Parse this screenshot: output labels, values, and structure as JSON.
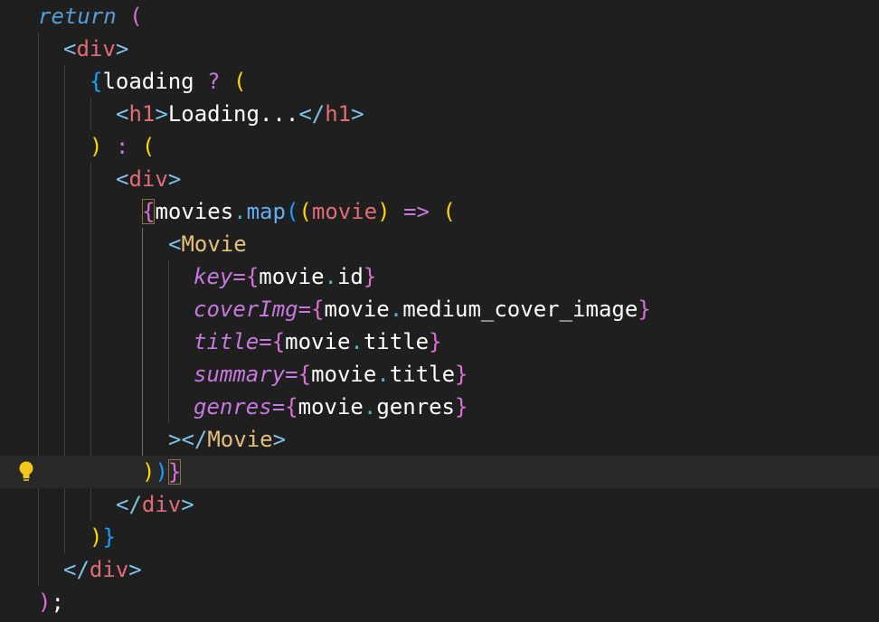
{
  "editor": {
    "lines": [
      {
        "tokens": [
          {
            "t": "return",
            "c": "ret"
          },
          {
            "t": " ",
            "c": "txt"
          },
          {
            "t": "(",
            "c": "b2"
          }
        ]
      },
      {
        "tokens": [
          {
            "t": "<",
            "c": "tagp"
          },
          {
            "t": "div",
            "c": "tag"
          },
          {
            "t": ">",
            "c": "tagp"
          }
        ]
      },
      {
        "tokens": [
          {
            "t": "{",
            "c": "b3"
          },
          {
            "t": "loading",
            "c": "var"
          },
          {
            "t": " ? ",
            "c": "op"
          },
          {
            "t": "(",
            "c": "b1"
          }
        ]
      },
      {
        "tokens": [
          {
            "t": "<",
            "c": "tagp"
          },
          {
            "t": "h1",
            "c": "tag"
          },
          {
            "t": ">",
            "c": "tagp"
          },
          {
            "t": "Loading...",
            "c": "txt"
          },
          {
            "t": "</",
            "c": "tagp"
          },
          {
            "t": "h1",
            "c": "tag"
          },
          {
            "t": ">",
            "c": "tagp"
          }
        ]
      },
      {
        "tokens": [
          {
            "t": ")",
            "c": "b1"
          },
          {
            "t": " : ",
            "c": "op"
          },
          {
            "t": "(",
            "c": "b1"
          }
        ]
      },
      {
        "tokens": [
          {
            "t": "<",
            "c": "tagp"
          },
          {
            "t": "div",
            "c": "tag"
          },
          {
            "t": ">",
            "c": "tagp"
          }
        ]
      },
      {
        "tokens": [
          {
            "t": "{",
            "c": "b2",
            "box": true
          },
          {
            "t": "movies",
            "c": "var"
          },
          {
            "t": ".",
            "c": "dot"
          },
          {
            "t": "map",
            "c": "fn"
          },
          {
            "t": "(",
            "c": "b3"
          },
          {
            "t": "(",
            "c": "b1"
          },
          {
            "t": "movie",
            "c": "param"
          },
          {
            "t": ")",
            "c": "b1"
          },
          {
            "t": " => ",
            "c": "op"
          },
          {
            "t": "(",
            "c": "b1"
          }
        ]
      },
      {
        "tokens": [
          {
            "t": "<",
            "c": "tagp"
          },
          {
            "t": "Movie",
            "c": "comp"
          }
        ]
      },
      {
        "tokens": [
          {
            "t": "key",
            "c": "attr"
          },
          {
            "t": "=",
            "c": "op"
          },
          {
            "t": "{",
            "c": "b2"
          },
          {
            "t": "movie",
            "c": "var"
          },
          {
            "t": ".",
            "c": "dot"
          },
          {
            "t": "id",
            "c": "var"
          },
          {
            "t": "}",
            "c": "b2"
          }
        ]
      },
      {
        "tokens": [
          {
            "t": "coverImg",
            "c": "attr"
          },
          {
            "t": "=",
            "c": "op"
          },
          {
            "t": "{",
            "c": "b2"
          },
          {
            "t": "movie",
            "c": "var"
          },
          {
            "t": ".",
            "c": "dot"
          },
          {
            "t": "medium_cover_image",
            "c": "var"
          },
          {
            "t": "}",
            "c": "b2"
          }
        ]
      },
      {
        "tokens": [
          {
            "t": "title",
            "c": "attr"
          },
          {
            "t": "=",
            "c": "op"
          },
          {
            "t": "{",
            "c": "b2"
          },
          {
            "t": "movie",
            "c": "var"
          },
          {
            "t": ".",
            "c": "dot"
          },
          {
            "t": "title",
            "c": "var"
          },
          {
            "t": "}",
            "c": "b2"
          }
        ]
      },
      {
        "tokens": [
          {
            "t": "summary",
            "c": "attr"
          },
          {
            "t": "=",
            "c": "op"
          },
          {
            "t": "{",
            "c": "b2"
          },
          {
            "t": "movie",
            "c": "var"
          },
          {
            "t": ".",
            "c": "dot"
          },
          {
            "t": "title",
            "c": "var"
          },
          {
            "t": "}",
            "c": "b2"
          }
        ]
      },
      {
        "tokens": [
          {
            "t": "genres",
            "c": "attr"
          },
          {
            "t": "=",
            "c": "op"
          },
          {
            "t": "{",
            "c": "b2"
          },
          {
            "t": "movie",
            "c": "var"
          },
          {
            "t": ".",
            "c": "dot"
          },
          {
            "t": "genres",
            "c": "var"
          },
          {
            "t": "}",
            "c": "b2"
          }
        ]
      },
      {
        "tokens": [
          {
            "t": "></",
            "c": "tagp"
          },
          {
            "t": "Movie",
            "c": "comp"
          },
          {
            "t": ">",
            "c": "tagp"
          }
        ]
      },
      {
        "tokens": [
          {
            "t": ")",
            "c": "b1"
          },
          {
            "t": ")",
            "c": "b3"
          },
          {
            "t": "}",
            "c": "b2",
            "box": true
          }
        ]
      },
      {
        "tokens": [
          {
            "t": "</",
            "c": "tagp"
          },
          {
            "t": "div",
            "c": "tag"
          },
          {
            "t": ">",
            "c": "tagp"
          }
        ]
      },
      {
        "tokens": [
          {
            "t": ")",
            "c": "b1"
          },
          {
            "t": "}",
            "c": "b3"
          }
        ]
      },
      {
        "tokens": [
          {
            "t": "</",
            "c": "tagp"
          },
          {
            "t": "div",
            "c": "tag"
          },
          {
            "t": ">",
            "c": "tagp"
          }
        ]
      },
      {
        "tokens": [
          {
            "t": ")",
            "c": "b2"
          },
          {
            "t": ";",
            "c": "txt"
          }
        ]
      }
    ],
    "lightbulb_icon": "lightbulb-icon",
    "colors": {
      "background": "#1f1f1f",
      "current_line": "#282828",
      "bracket_gold": "#ffd700",
      "bracket_pink": "#da70d6",
      "bracket_blue": "#179fff",
      "tag": "#e06c75",
      "component": "#e5c07b",
      "attribute": "#c678dd"
    }
  }
}
